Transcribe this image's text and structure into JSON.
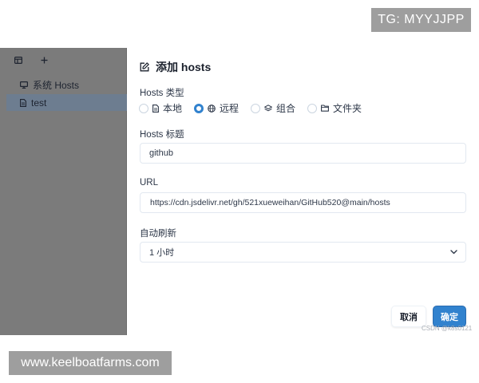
{
  "overlay": {
    "tg_label": "TG: MYYJJPP",
    "site_label": "www.keelboatfarms.com"
  },
  "sidebar": {
    "toolbar": [
      {
        "icon": "sidebar-toggle-icon"
      },
      {
        "icon": "plus-icon",
        "label": "+"
      }
    ],
    "items": [
      {
        "icon": "monitor-icon",
        "label": "系统 Hosts",
        "active": false
      },
      {
        "icon": "document-icon",
        "label": "test",
        "active": true
      }
    ]
  },
  "dialog": {
    "title_icon": "edit-icon",
    "title": "添加 hosts",
    "type_label": "Hosts 类型",
    "type_options": [
      {
        "icon": "document-icon",
        "label": "本地",
        "checked": false
      },
      {
        "icon": "globe-icon",
        "label": "远程",
        "checked": true
      },
      {
        "icon": "layers-icon",
        "label": "组合",
        "checked": false
      },
      {
        "icon": "folder-icon",
        "label": "文件夹",
        "checked": false
      }
    ],
    "title_label": "Hosts 标题",
    "title_value": "github",
    "url_label": "URL",
    "url_value": "https://cdn.jsdelivr.net/gh/521xueweihan/GitHub520@main/hosts",
    "refresh_label": "自动刷新",
    "refresh_value": "1 小时",
    "cancel_label": "取消",
    "ok_label": "确定",
    "watermark": "CSDN @k8s0121"
  },
  "colors": {
    "accent": "#3182ce",
    "sidebar_bg": "#7b7b7b",
    "sidebar_active": "#6d7d90",
    "overlay_badge": "#9e9e9e"
  }
}
